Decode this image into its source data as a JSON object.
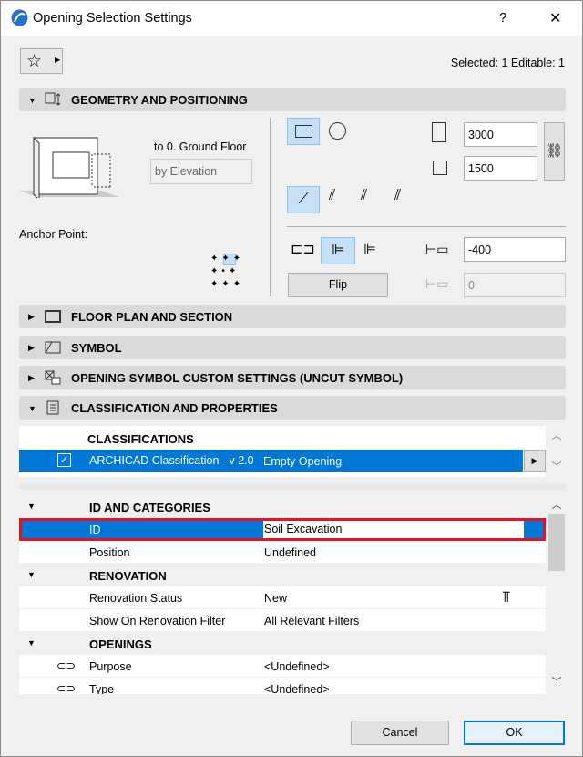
{
  "window": {
    "title": "Opening Selection Settings",
    "help": "?",
    "close": "✕"
  },
  "toolbar": {
    "selection_info": "Selected: 1 Editable: 1"
  },
  "sections": {
    "geometry": "GEOMETRY AND POSITIONING",
    "floor_plan": "FLOOR PLAN AND SECTION",
    "symbol": "SYMBOL",
    "custom": "OPENING SYMBOL CUSTOM SETTINGS (UNCUT SYMBOL)",
    "classification": "CLASSIFICATION AND PROPERTIES"
  },
  "geometry": {
    "floor": "to 0. Ground Floor",
    "elevation_mode": "by Elevation",
    "anchor_label": "Anchor Point:",
    "width": "3000",
    "height": "1500",
    "offset": "-400",
    "offset2": "0",
    "flip": "Flip"
  },
  "classifications": {
    "header": "CLASSIFICATIONS",
    "row": {
      "system": "ARCHICAD Classification - v 2.0",
      "value": "Empty Opening",
      "checked": true
    }
  },
  "properties": {
    "groups": [
      {
        "name": "ID AND CATEGORIES",
        "rows": [
          {
            "label": "ID",
            "value": "Soil Excavation"
          },
          {
            "label": "Position",
            "value": "Undefined"
          }
        ]
      },
      {
        "name": "RENOVATION",
        "rows": [
          {
            "label": "Renovation Status",
            "value": "New"
          },
          {
            "label": "Show On Renovation Filter",
            "value": "All Relevant Filters"
          }
        ]
      },
      {
        "name": "OPENINGS",
        "rows": [
          {
            "label": "Purpose",
            "value": "<Undefined>"
          },
          {
            "label": "Type",
            "value": "<Undefined>"
          }
        ]
      }
    ]
  },
  "footer": {
    "cancel": "Cancel",
    "ok": "OK"
  },
  "colors": {
    "selection": "#0078d7",
    "highlight_border": "#e81123"
  }
}
